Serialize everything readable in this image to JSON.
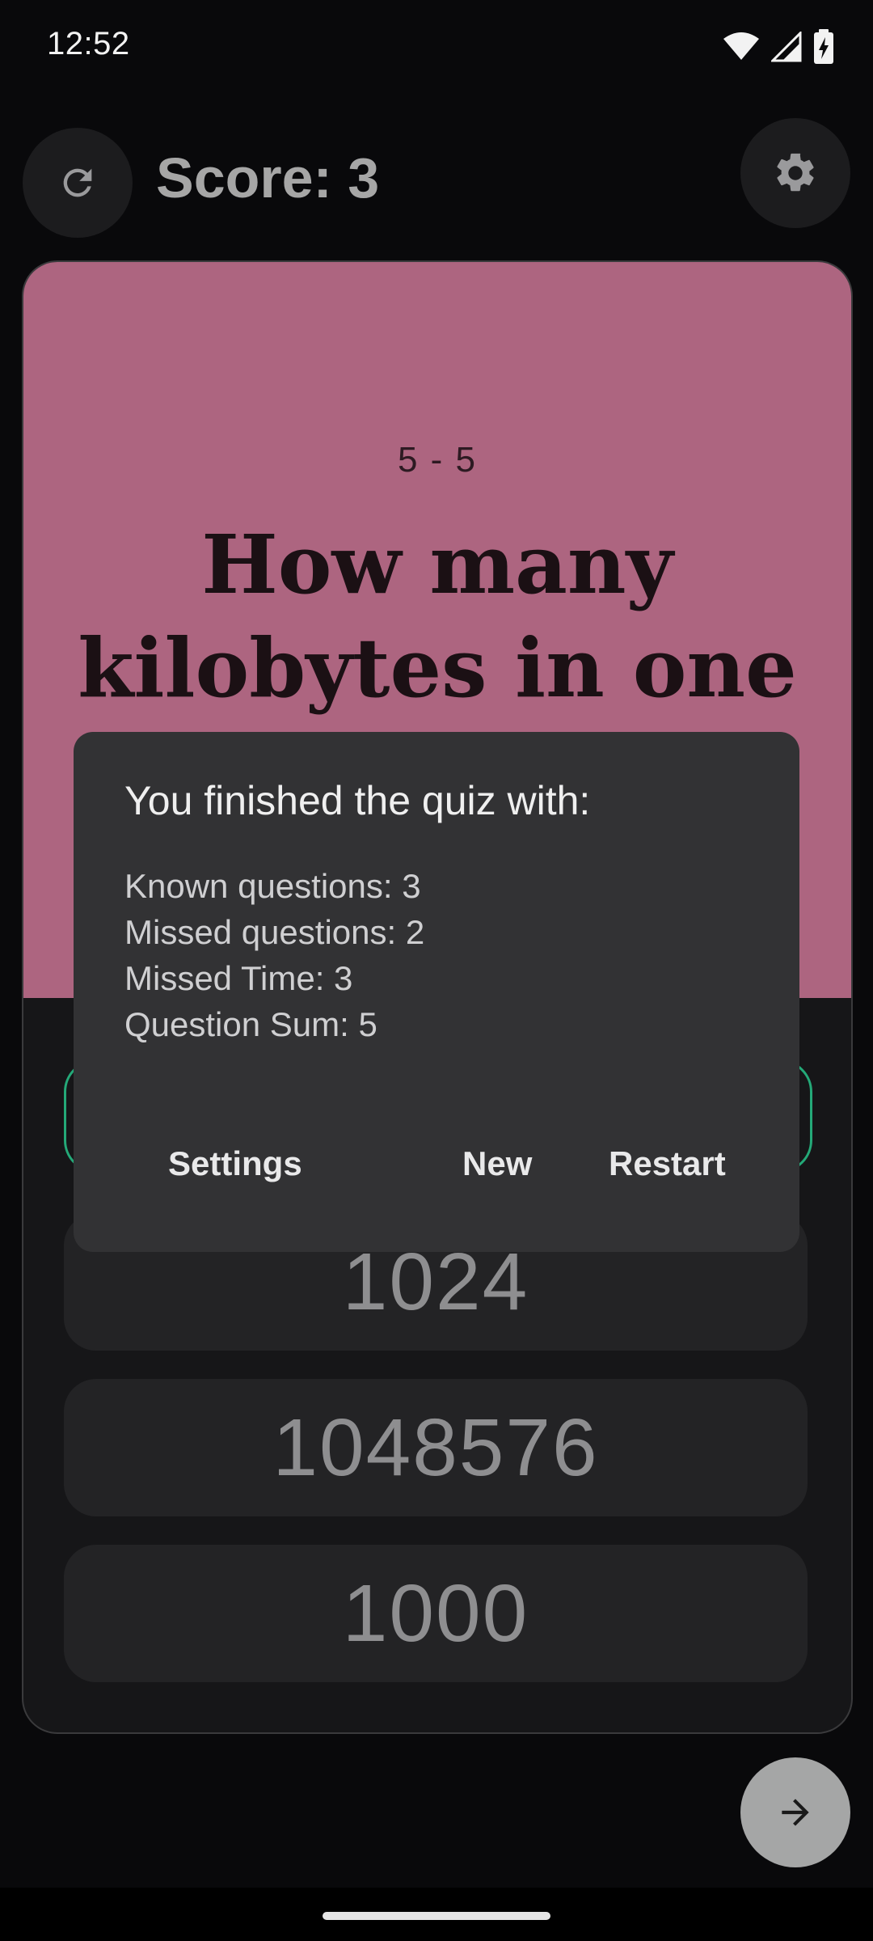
{
  "status_bar": {
    "time": "12:52"
  },
  "top_bar": {
    "score": "Score: 3"
  },
  "card": {
    "progress": "5 - 5",
    "question": "How many kilobytes in one",
    "answers": [
      "1024",
      "1048576",
      "1000"
    ]
  },
  "dialog": {
    "title": "You finished the quiz with:",
    "lines": [
      "Known questions: 3",
      "Missed questions: 2",
      "Missed Time: 3",
      "Question Sum: 5"
    ],
    "buttons": {
      "settings": "Settings",
      "new": "New",
      "restart": "Restart"
    }
  },
  "colors": {
    "card_top": "#ad6580",
    "highlight_border": "#24a978",
    "dialog_bg": "#323234"
  },
  "icons": [
    "refresh-icon",
    "gear-icon",
    "arrow-right-icon",
    "wifi-icon",
    "signal-icon",
    "battery-icon"
  ]
}
